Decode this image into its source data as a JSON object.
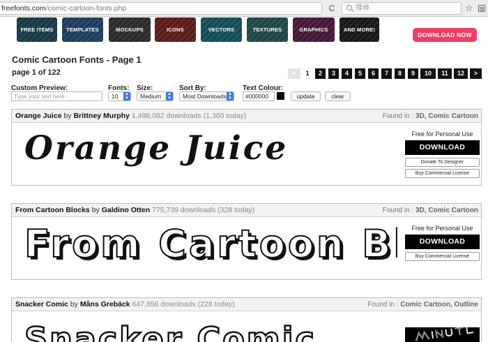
{
  "browser": {
    "url_host": "freefonts.com",
    "url_path": "/comic-cartoon-fonts.php",
    "reload": "C",
    "search_placeholder": "搜尋",
    "star": "☆"
  },
  "nav": {
    "categories": [
      {
        "label": "FREE ITEMS",
        "color": "#173a47"
      },
      {
        "label": "TEMPLATES",
        "color": "#1d3f63"
      },
      {
        "label": "MOCKUPS",
        "color": "#2b2b2b"
      },
      {
        "label": "ICONS",
        "color": "#5e1c18"
      },
      {
        "label": "VECTORS",
        "color": "#14505b"
      },
      {
        "label": "TEXTURES",
        "color": "#1e4a48"
      },
      {
        "label": "GRAPHICS",
        "color": "#47173b"
      },
      {
        "label": "AND MORE!",
        "color": "#181818"
      }
    ],
    "download_now": "DOWNLOAD NOW",
    "download_now_color": "#ee3f62"
  },
  "page": {
    "title": "Comic Cartoon Fonts - Page 1",
    "count": "page 1 of 122"
  },
  "pagination": {
    "prev": "<",
    "current": "1",
    "pages": [
      "2",
      "3",
      "4",
      "5",
      "6",
      "7",
      "8",
      "9",
      "10",
      "11",
      "12"
    ],
    "next": ">"
  },
  "controls": {
    "custom_preview_label": "Custom Preview:",
    "custom_preview_placeholder": "Type your text here",
    "fonts_label": "Fonts:",
    "fonts_value": "10",
    "size_label": "Size:",
    "size_value": "Medium",
    "sort_label": "Sort By:",
    "sort_value": "Most Downloads",
    "text_colour_label": "Text Colour:",
    "text_colour_value": "#000000",
    "update": "update",
    "clear": "clear"
  },
  "fonts": [
    {
      "name": "Orange Juice",
      "by": "by",
      "author": "Brittney Murphy",
      "downloads": "1,498,082 downloads (1,360 today)",
      "found_label": "Found in :",
      "found_in": "3D, Comic Cartoon",
      "preview": "Orange Juice",
      "license": "Free for Personal Use",
      "download": "DOWNLOAD",
      "donate": "Donate To Designer",
      "buy": "Buy Commercial License"
    },
    {
      "name": "From Cartoon Blocks",
      "by": "by",
      "author": "Galdino Otten",
      "downloads": "775,739 downloads (328 today)",
      "found_label": "Found in :",
      "found_in": "3D, Comic Cartoon",
      "preview": "From Cartoon Blocks",
      "license": "Free for Personal Use",
      "download": "DOWNLOAD",
      "buy": "Buy Commercial License"
    },
    {
      "name": "Snacker Comic",
      "by": "by",
      "author": "Måns Grebäck",
      "downloads": "647,656 downloads (228 today)",
      "found_label": "Found in :",
      "found_in": "Comic Cartoon, Outline",
      "preview": "Snacker Comic"
    }
  ]
}
